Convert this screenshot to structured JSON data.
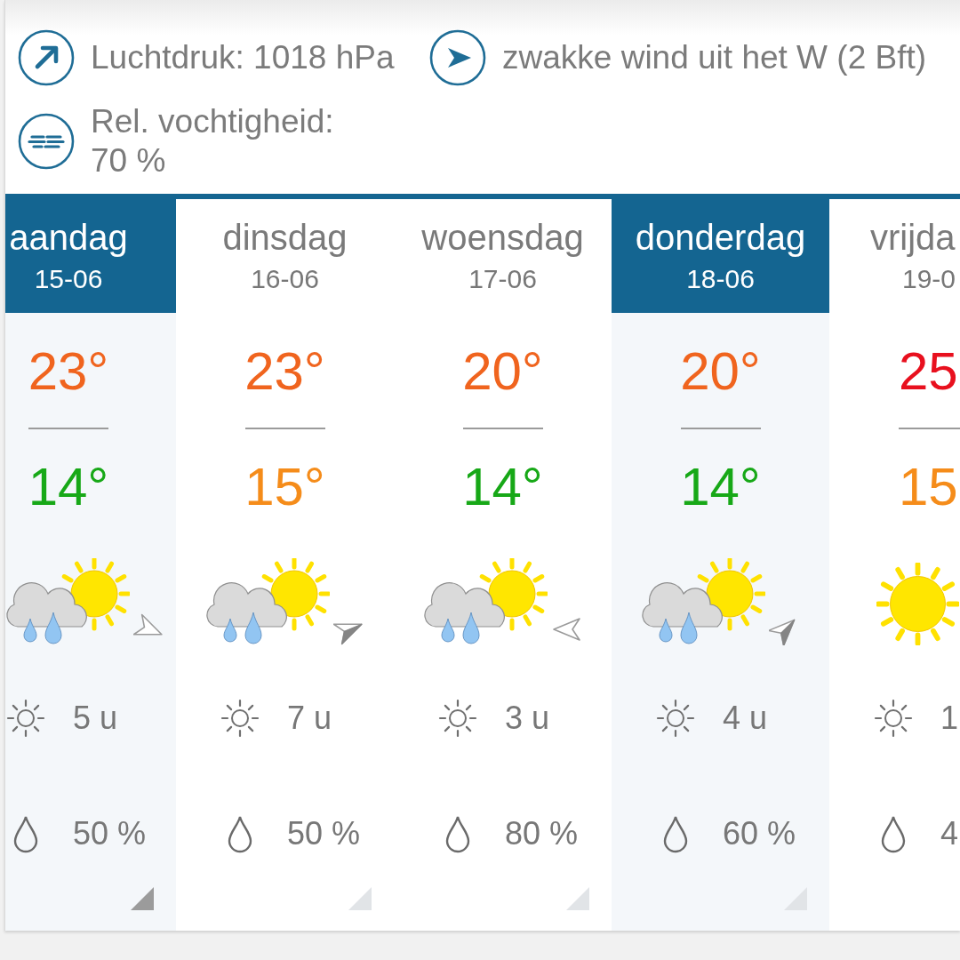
{
  "details": [
    {
      "kind": "pressure",
      "text": "Luchtdruk: 1018 hPa"
    },
    {
      "kind": "wind",
      "text": "zwakke wind uit het W (2 Bft)"
    },
    {
      "kind": "humidity",
      "text": "Rel. vochtigheid: 70 %"
    }
  ],
  "days": [
    {
      "name": "aandag",
      "date": "15-06",
      "selected": true,
      "high": {
        "text": "23°",
        "color": "#f0641e"
      },
      "low": {
        "text": "14°",
        "color": "#17a817"
      },
      "weather": {
        "kind": "sun-cloud-rain"
      },
      "wind_arrow": {
        "filled": false,
        "kind": "ESE"
      },
      "sunshine": "5 u",
      "rain_chance": "50 %",
      "corner_marker": {
        "active": true
      }
    },
    {
      "name": "dinsdag",
      "date": "16-06",
      "selected": false,
      "high": {
        "text": "23°",
        "color": "#f0641e"
      },
      "low": {
        "text": "15°",
        "color": "#f58c1a"
      },
      "weather": {
        "kind": "sun-cloud-rain"
      },
      "wind_arrow": {
        "filled": true,
        "kind": "ENE"
      },
      "sunshine": "7 u",
      "rain_chance": "50 %",
      "corner_marker": {
        "active": false
      }
    },
    {
      "name": "woensdag",
      "date": "17-06",
      "selected": false,
      "high": {
        "text": "20°",
        "color": "#f0641e"
      },
      "low": {
        "text": "14°",
        "color": "#17a817"
      },
      "weather": {
        "kind": "sun-cloud-rain"
      },
      "wind_arrow": {
        "filled": false,
        "kind": "W"
      },
      "sunshine": "3 u",
      "rain_chance": "80 %",
      "corner_marker": {
        "active": false
      }
    },
    {
      "name": "donderdag",
      "date": "18-06",
      "selected": true,
      "high": {
        "text": "20°",
        "color": "#f0641e"
      },
      "low": {
        "text": "14°",
        "color": "#17a817"
      },
      "weather": {
        "kind": "sun-cloud-rain"
      },
      "wind_arrow": {
        "filled": true,
        "kind": "NE"
      },
      "sunshine": "4 u",
      "rain_chance": "60 %",
      "corner_marker": {
        "active": false
      }
    },
    {
      "name": "vrijda",
      "date": "19-0",
      "selected": false,
      "high": {
        "text": "25",
        "color": "#e8101e"
      },
      "low": {
        "text": "15",
        "color": "#f58c1a"
      },
      "weather": {
        "kind": "sunny"
      },
      "sunshine": "1",
      "rain_chance": "4"
    }
  ]
}
